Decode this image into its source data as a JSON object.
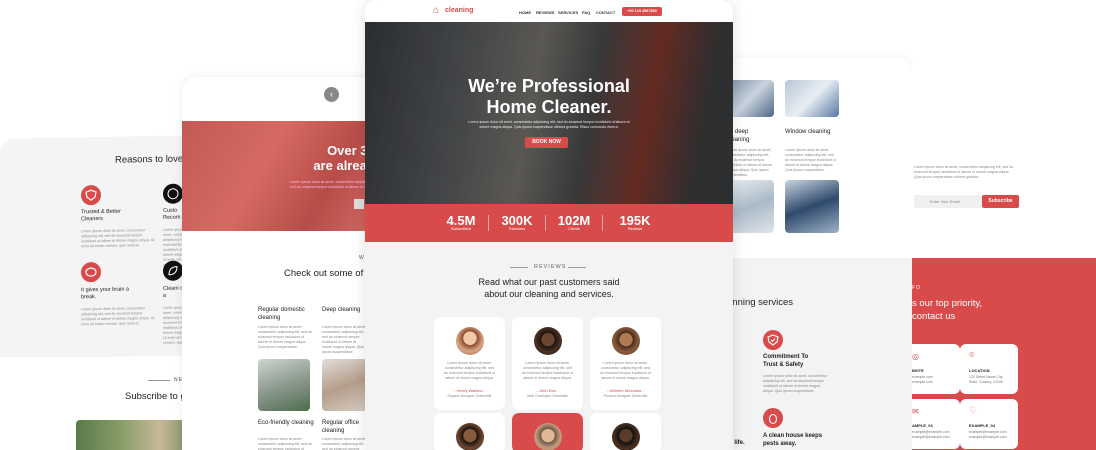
{
  "far_left": {
    "heading": "Reasons to love",
    "features": [
      {
        "title": "Trusted & Better Cleaners",
        "icon": "shield-icon"
      },
      {
        "title": "Custo Recom",
        "icon": "thumbs-icon"
      },
      {
        "title": "It gives your brain a break.",
        "icon": "brain-icon"
      },
      {
        "title": "Cleani other a",
        "icon": "leaf-icon"
      }
    ],
    "lorem": "Lorem ipsum dolor sit amet, consectetur adipiscing elit, sed do eiusmod tempor incididunt ut labore et dolore magna aliqua. Ut enim ad minim veniam, quis nostrud.",
    "newsletter_tag": "NE",
    "subscribe_heading": "Subscribe to g"
  },
  "left": {
    "hero_heading": "Over 300 are already u",
    "hero_lorem": "Lorem ipsum dolor sit amet, consectetur adipiscing elit, sed do eiusmod tempor incididunt ut labore et dolore",
    "section_tag": "W",
    "section_heading": "Check out some of",
    "services": [
      {
        "title": "Regular domestic cleaning"
      },
      {
        "title": "Deep cleaning"
      },
      {
        "title": "Eco-friendly cleaning"
      },
      {
        "title": "Regular office cleaning"
      }
    ],
    "lorem": "Lorem ipsum dolor sit amet, consectetur adipiscing elit, sed do eiusmod tempor incididunt ut labore et dolore magna aliqua. Quis ipsum suspendisse."
  },
  "center": {
    "brand": "cleaning",
    "nav": [
      "HOME",
      "REVIEWS",
      "SERVICES",
      "FAQ",
      "CONTACT"
    ],
    "phone": "+00 123 4567890",
    "hero_title_1": "We’re Professional",
    "hero_title_2": "Home Cleaner.",
    "hero_sub": "Lorem ipsum dolor sit amet, consectetur adipiscing elit, sed do eiusmod tempor incididunt ut labore et dolore magna aliqua. Quis ipsum suspendisse ultrices gravida. Risus commodo viverra.",
    "cta": "BOOK NOW",
    "stats": [
      {
        "value": "4.5M",
        "label": "Subscribers"
      },
      {
        "value": "300K",
        "label": "Followers"
      },
      {
        "value": "102M",
        "label": "Clients"
      },
      {
        "value": "195K",
        "label": "Reviews"
      }
    ],
    "reviews_tag": "REVIEWS",
    "reviews_heading_1": "Read what our past customers said",
    "reviews_heading_2": "about our cleaning and services.",
    "review_lorem": "Lorem ipsum dolor sit amet, consectetur adipiscing elit, sed do eiusmod tempor incididunt ut labore et dolore magna aliqua.",
    "reviews": [
      {
        "name": "- Henry Walkins -",
        "role": "Graphic Designer Greenville"
      },
      {
        "name": "- John Doe -",
        "role": "Web Developer Greenville"
      },
      {
        "name": "- Wilhelm Mozuskie -",
        "role": "Product Designer Greenville"
      }
    ]
  },
  "right": {
    "services": [
      {
        "title": "ce deep cleaning"
      },
      {
        "title": "Window cleaning"
      }
    ],
    "lorem": "Lorem ipsum dolor sit amet, consectetur adipiscing elit, sed do eiusmod tempor incididunt ut labore et dolore magna aliqua. Quis ipsum suspendisse.",
    "section_heading": "anning services",
    "features": [
      {
        "title": "Commitment To Trust & Safety",
        "icon": "shield-check-icon"
      },
      {
        "title": "A clean house keeps pests away.",
        "icon": "bug-icon"
      }
    ],
    "partial_text": "er life."
  },
  "far_right": {
    "lorem": "Lorem ipsum dolor sit amet, consectetur adipiscing elit, sed do eiusmod tempor incididunt ut labore et dolore magna aliqua. Quis ipsum suspendisse ultrices gravida.",
    "email_placeholder": "Enter Your Email",
    "subscribe_button": "Subscribe",
    "info_tag": "FO",
    "info_heading_1": "s our top priority,",
    "info_heading_2": "contact us",
    "boxes": [
      {
        "label": "BSITE",
        "line1": "example.com",
        "line2": "example.com",
        "icon": "globe-icon"
      },
      {
        "label": "LOCATION",
        "line1": "123 Street Name City,",
        "line2": "State, Country, 12345",
        "icon": "pin-icon"
      },
      {
        "label": "AMPLE_03",
        "line1": "example@example.com",
        "line2": "example@example.com",
        "icon": "mail-icon"
      },
      {
        "label": "EXAMPLE_04",
        "line1": "example@example.com",
        "line2": "example@example.com",
        "icon": "heart-icon"
      }
    ]
  },
  "colors": {
    "accent": "#d94b4b",
    "bg_light": "#f3f3f3"
  }
}
